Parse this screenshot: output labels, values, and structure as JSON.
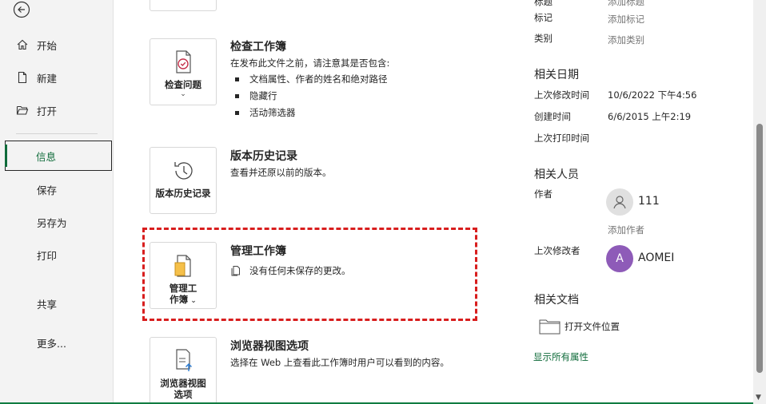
{
  "nav": {
    "items": [
      {
        "id": "home",
        "label": "开始",
        "icon": "home-icon"
      },
      {
        "id": "new",
        "label": "新建",
        "icon": "new-document-icon"
      },
      {
        "id": "open",
        "label": "打开",
        "icon": "open-folder-icon"
      },
      {
        "id": "info",
        "label": "信息",
        "active": true
      },
      {
        "id": "save",
        "label": "保存"
      },
      {
        "id": "saveas",
        "label": "另存为"
      },
      {
        "id": "print",
        "label": "打印"
      },
      {
        "id": "share",
        "label": "共享"
      },
      {
        "id": "more",
        "label": "更多..."
      }
    ]
  },
  "sections": {
    "inspect": {
      "button_label": "检查问题",
      "title": "检查工作簿",
      "desc": "在发布此文件之前，请注意其是否包含:",
      "bullets": [
        "文档属性、作者的姓名和绝对路径",
        "隐藏行",
        "活动筛选器"
      ]
    },
    "versions": {
      "button_label": "版本历史记录",
      "title": "版本历史记录",
      "desc": "查看并还原以前的版本。"
    },
    "manage": {
      "button_label_line1": "管理工",
      "button_label_line2": "作簿",
      "title": "管理工作簿",
      "desc": "没有任何未保存的更改。"
    },
    "browser": {
      "button_label_line1": "浏览器视图",
      "button_label_line2": "选项",
      "title": "浏览器视图选项",
      "desc": "选择在 Web 上查看此工作簿时用户可以看到的内容。"
    }
  },
  "properties": {
    "title_partial": {
      "label": "标题",
      "value": "添加标题"
    },
    "tags": {
      "label": "标记",
      "value": "添加标记"
    },
    "category": {
      "label": "类别",
      "value": "添加类别"
    },
    "dates_heading": "相关日期",
    "modified": {
      "label": "上次修改时间",
      "value": "10/6/2022 下午4:56"
    },
    "created": {
      "label": "创建时间",
      "value": "6/6/2015 上午2:19"
    },
    "printed": {
      "label": "上次打印时间",
      "value": ""
    },
    "people_heading": "相关人员",
    "author_label": "作者",
    "author_name": "111",
    "add_author": "添加作者",
    "last_modified_by_label": "上次修改者",
    "last_modified_by_initial": "A",
    "last_modified_by_name": "AOMEI",
    "docs_heading": "相关文档",
    "open_location": "打开文件位置",
    "show_all": "显示所有属性"
  },
  "colors": {
    "accent_green": "#0f6b3a",
    "highlight_red": "#d81e1e",
    "avatar_purple": "#8e5bb8"
  }
}
